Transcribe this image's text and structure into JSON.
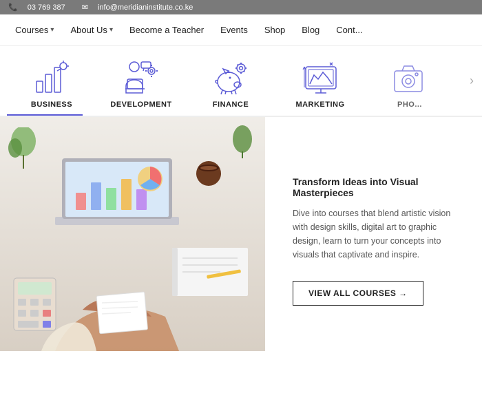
{
  "topbar": {
    "phone": "03 769 387",
    "email": "info@meridianinstitute.co.ke"
  },
  "nav": {
    "items": [
      {
        "label": "Courses",
        "hasDropdown": true
      },
      {
        "label": "About Us",
        "hasDropdown": true
      },
      {
        "label": "Become a Teacher",
        "hasDropdown": false
      },
      {
        "label": "Events",
        "hasDropdown": false
      },
      {
        "label": "Shop",
        "hasDropdown": false
      },
      {
        "label": "Blog",
        "hasDropdown": false
      },
      {
        "label": "Cont...",
        "hasDropdown": false
      }
    ]
  },
  "categories": [
    {
      "id": "business",
      "label": "BUSINESS"
    },
    {
      "id": "development",
      "label": "DEVELOPMENT"
    },
    {
      "id": "finance",
      "label": "FINANCE"
    },
    {
      "id": "marketing",
      "label": "MARKETING"
    },
    {
      "id": "photography",
      "label": "PHO..."
    }
  ],
  "hero": {
    "title": "Transform Ideas into Visual Masterpieces",
    "description": "Dive into courses that blend artistic vision with design skills, digital art to graphic design, learn to turn your concepts into visuals that captivate and inspire.",
    "cta_label": "VIEW ALL COURSES →"
  }
}
